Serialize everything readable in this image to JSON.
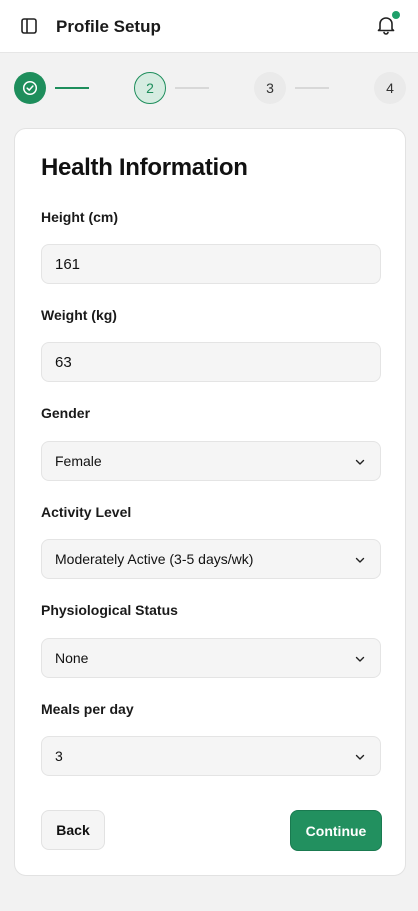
{
  "header": {
    "title": "Profile Setup",
    "sidebar_icon": "sidebar-icon",
    "notification_icon": "bell-icon",
    "has_unread": true,
    "accent": "#20a06b"
  },
  "stepper": {
    "current": 2,
    "steps": [
      {
        "label": "",
        "state": "completed",
        "icon": "check-circle-icon"
      },
      {
        "label": "2",
        "state": "active"
      },
      {
        "label": "3",
        "state": "pending"
      },
      {
        "label": "4",
        "state": "pending"
      }
    ]
  },
  "form": {
    "title": "Health Information",
    "height": {
      "label": "Height (cm)",
      "value": "161"
    },
    "weight": {
      "label": "Weight (kg)",
      "value": "63"
    },
    "gender": {
      "label": "Gender",
      "value": "Female"
    },
    "activity": {
      "label": "Activity Level",
      "value": "Moderately Active (3-5 days/wk)"
    },
    "physiological": {
      "label": "Physiological Status",
      "value": "None"
    },
    "meals": {
      "label": "Meals per day",
      "value": "3"
    }
  },
  "actions": {
    "back_label": "Back",
    "continue_label": "Continue"
  },
  "colors": {
    "primary": "#22905f",
    "primary_light": "#d6ece1"
  }
}
